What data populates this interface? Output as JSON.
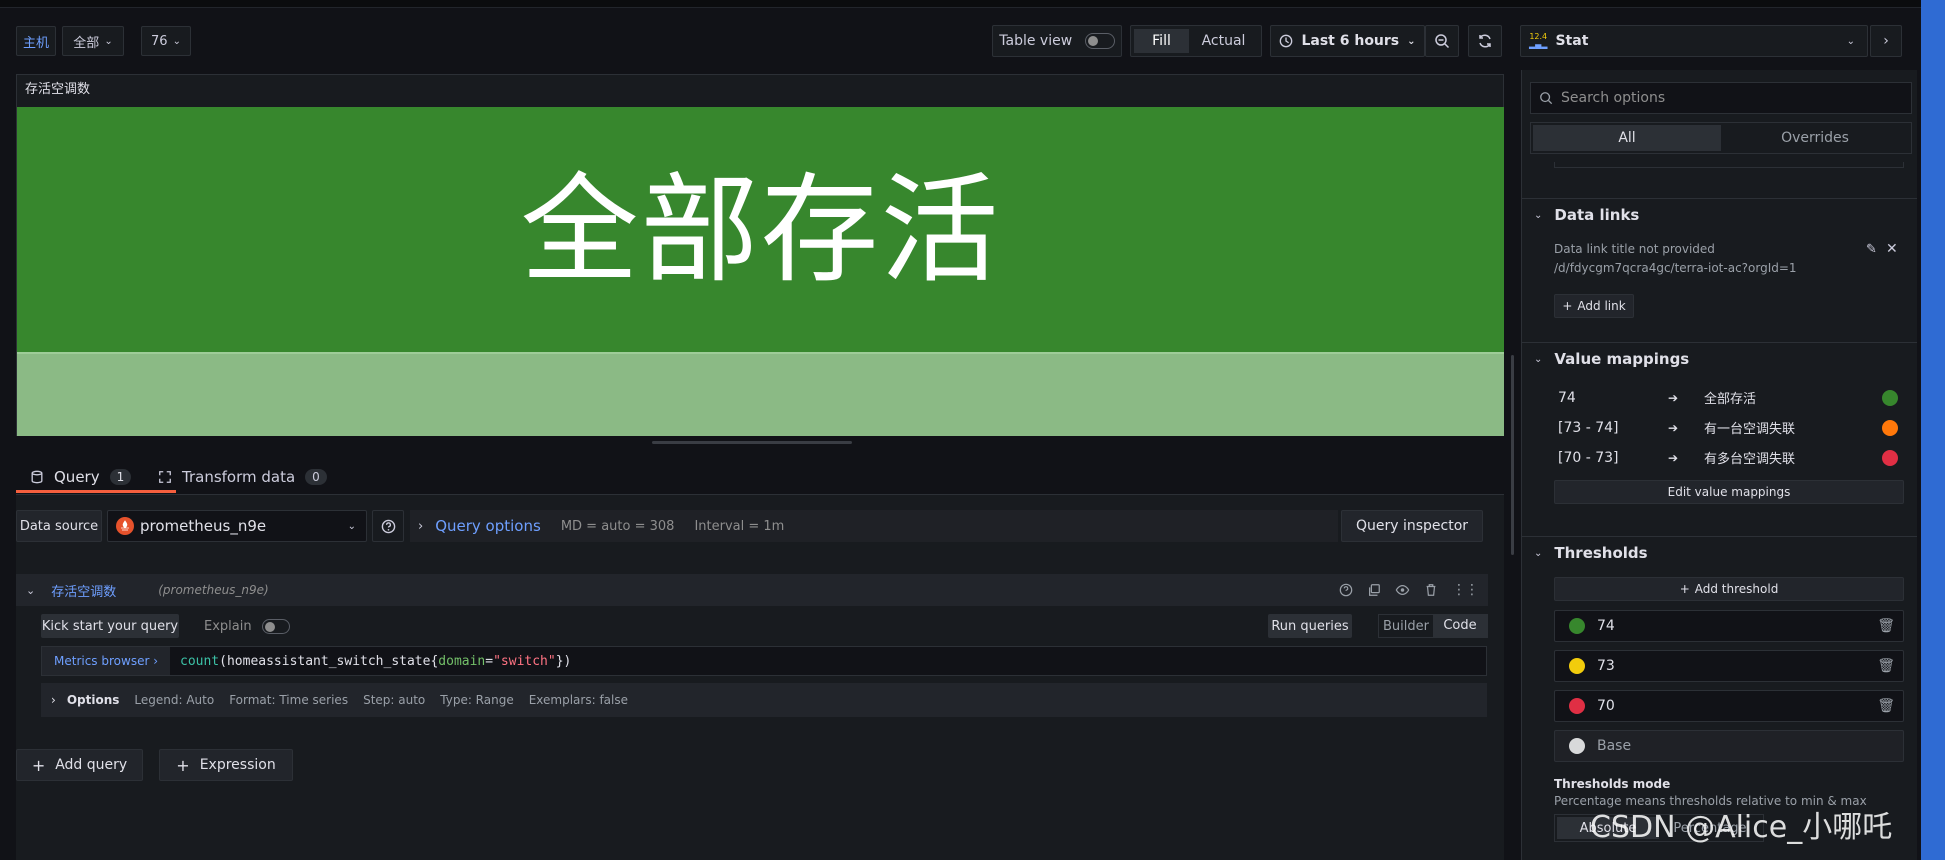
{
  "toolbar": {
    "var1_label": "主机",
    "var1_value": "全部",
    "var2_value": "76",
    "table_view_label": "Table view",
    "fill_label": "Fill",
    "actual_label": "Actual",
    "time_range": "Last 6 hours",
    "viz_badge": "12.4",
    "viz_name": "Stat"
  },
  "panel": {
    "title": "存活空调数",
    "stat_text": "全部存活",
    "color_main": "#37872d",
    "color_spark": "#8bba85"
  },
  "query_tabs": {
    "query_label": "Query",
    "query_count": "1",
    "transform_label": "Transform data",
    "transform_count": "0"
  },
  "datasource": {
    "label": "Data source",
    "name": "prometheus_n9e",
    "query_options_label": "Query options",
    "md": "MD = auto = 308",
    "interval": "Interval = 1m",
    "inspector_label": "Query inspector"
  },
  "query": {
    "name": "存活空调数",
    "ds_hint": "(prometheus_n9e)",
    "kick_start": "Kick start your query",
    "explain": "Explain",
    "run": "Run queries",
    "builder": "Builder",
    "code": "Code",
    "metrics_browser": "Metrics browser ›",
    "expr_func": "count",
    "expr_open": "(homeassistant_switch_state{",
    "expr_key": "domain",
    "expr_eq": "=",
    "expr_val": "\"switch\"",
    "expr_close": "})",
    "options_label": "Options",
    "legend": "Legend: Auto",
    "format": "Format: Time series",
    "step": "Step: auto",
    "type": "Type: Range",
    "exemplars": "Exemplars: false"
  },
  "bottom_buttons": {
    "add_query": "Add query",
    "expression": "Expression"
  },
  "options_pane": {
    "search_placeholder": "Search options",
    "tab_all": "All",
    "tab_overrides": "Overrides",
    "data_links": {
      "title": "Data links",
      "link_title": "Data link title not provided",
      "link_url": "/d/fdycgm7qcra4gc/terra-iot-ac?orgId=1",
      "add_link": "Add link"
    },
    "value_mappings": {
      "title": "Value mappings",
      "rows": [
        {
          "value": "74",
          "text": "全部存活",
          "color": "#37872d"
        },
        {
          "value": "[73 - 74]",
          "text": "有一台空调失联",
          "color": "#ff780a"
        },
        {
          "value": "[70 - 73]",
          "text": "有多台空调失联",
          "color": "#e02f44"
        }
      ],
      "edit": "Edit value mappings"
    },
    "thresholds": {
      "title": "Thresholds",
      "add": "Add threshold",
      "rows": [
        {
          "value": "74",
          "color": "#37872d"
        },
        {
          "value": "73",
          "color": "#f2cc0c"
        },
        {
          "value": "70",
          "color": "#e02f44"
        },
        {
          "value": "Base",
          "color": "#d8d9da"
        }
      ],
      "mode_title": "Thresholds mode",
      "mode_desc": "Percentage means thresholds relative to min & max",
      "absolute": "Absolute",
      "percentage": "Percentage"
    }
  },
  "watermark": "CSDN @Alice_小哪吒"
}
